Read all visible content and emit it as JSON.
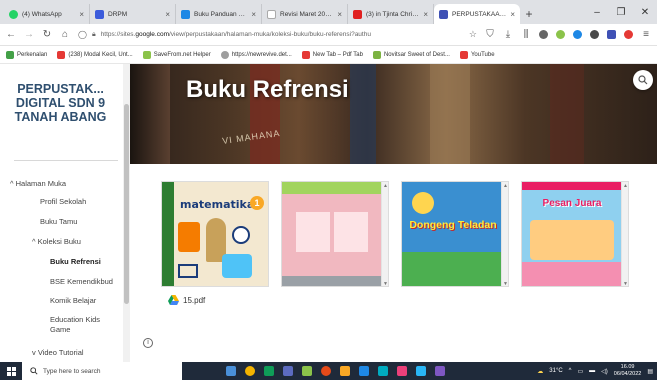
{
  "browser": {
    "tabs": [
      {
        "label": "(4) WhatsApp",
        "color": "#25d366",
        "active": false
      },
      {
        "label": "DRPM",
        "color": "#3b5bdb",
        "active": false
      },
      {
        "label": "Buku Panduan Pengabdi",
        "color": "#1e88e5",
        "active": false
      },
      {
        "label": "Revisi Maret 2022 PANDUAN",
        "color": "#ffffff",
        "active": false
      },
      {
        "label": "(3) in Tjinta Christie, Nick",
        "color": "#e02020",
        "active": false
      },
      {
        "label": "PERPUSTAKAAN DIGITAL",
        "color": "#3f51b5",
        "active": true
      }
    ],
    "new_tab": "+",
    "window_controls": [
      "–",
      "❐",
      "✕"
    ],
    "url_prefix": "https://sites.",
    "url_domain": "google.com",
    "url_rest": "/view/perpustakaan/halaman-muka/koleksi-buku/buku-referensi?authu",
    "bookmarks": [
      {
        "label": "Perkenalan",
        "color": "#43a047"
      },
      {
        "label": "(238) Modal Kecil, Unt...",
        "color": "#e53935"
      },
      {
        "label": "SaveFrom.net Helper",
        "color": "#8bc34a"
      },
      {
        "label": "https://newrevive.det...",
        "color": "#9e9e9e"
      },
      {
        "label": "New Tab – Pdf Tab",
        "color": "#e53935"
      },
      {
        "label": "Novitsar Sweet of Dest...",
        "color": "#7cb342"
      },
      {
        "label": "YouTube",
        "color": "#e53935"
      }
    ]
  },
  "site": {
    "title": "PERPUSTAK... DIGITAL SDN 9 TANAH ABANG",
    "nav": [
      {
        "label": "^ Halaman Muka",
        "selected": false
      },
      {
        "label": "Profil Sekolah",
        "selected": false
      },
      {
        "label": "Buku Tamu",
        "selected": false
      },
      {
        "label": "^ Koleksi Buku",
        "selected": false
      },
      {
        "label": "Buku Refrensi",
        "selected": true
      },
      {
        "label": "BSE Kemendikbud",
        "selected": false
      },
      {
        "label": "Komik Belajar",
        "selected": false
      },
      {
        "label": "Education Kids Game",
        "selected": false
      },
      {
        "label": "v Video Tutorial",
        "selected": false
      }
    ],
    "banner_title": "Buku Refrensi",
    "banner_text": "VI MAHANA",
    "books": [
      {
        "cover_title": "matematika",
        "cover_badge": "1",
        "cover_bg": "#f3e8d0"
      },
      {
        "cover_title": "",
        "cover_bg": "#f1b8c0"
      },
      {
        "cover_title": "Dongeng Teladan",
        "cover_bg": "#3a8fd0"
      },
      {
        "cover_title": "Pesan Juara",
        "cover_bg": "#8fd0ef"
      }
    ],
    "file_label": "15.pdf",
    "info_glyph": "i"
  },
  "taskbar": {
    "search_placeholder": "Type here to search",
    "weather": "31°C",
    "time": "16.09",
    "date": "06/04/2022",
    "app_colors": [
      "#4a90d9",
      "#f4b400",
      "#0f9d58",
      "#5c6bc0",
      "#8bc34a",
      "#e64a19",
      "#f9a825",
      "#1e88e5",
      "#00acc1",
      "#ec407a",
      "#29b6f6",
      "#7e57c2"
    ]
  }
}
